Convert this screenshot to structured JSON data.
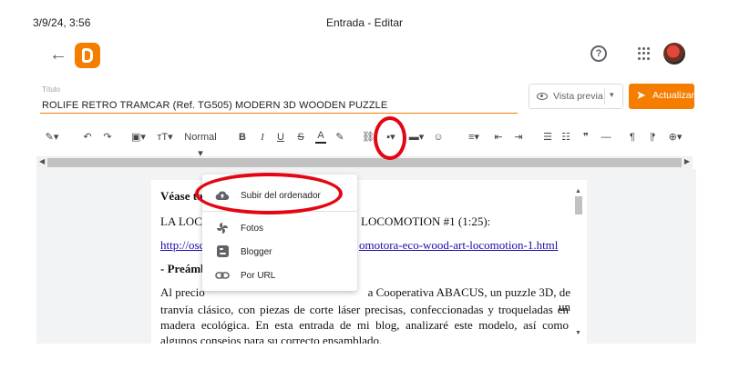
{
  "print_header": {
    "date": "3/9/24, 3:56",
    "title": "Entrada - Editar"
  },
  "appbar": {
    "help_glyph": "?"
  },
  "post": {
    "title_label": "Título",
    "title_value": "ROLIFE RETRO TRAMCAR (Ref. TG505) MODERN 3D WOODEN PUZZLE"
  },
  "actions": {
    "preview_label": "Vista previa",
    "update_label": "Actualizar"
  },
  "toolbar": {
    "paragraph_style": "Normal",
    "glyphs": {
      "bold": "B",
      "italic": "I",
      "underline": "U",
      "strike": "S",
      "text_color": "A",
      "quote": "❞",
      "hr": "—",
      "ltr": "¶",
      "rtl": "¶"
    }
  },
  "insert_menu": {
    "items": [
      {
        "label": "Subir del ordenador",
        "icon": "cloud-upload-icon"
      },
      {
        "label": "Fotos",
        "icon": "google-photos-icon"
      },
      {
        "label": "Blogger",
        "icon": "blogger-icon"
      },
      {
        "label": "Por URL",
        "icon": "link-icon"
      }
    ]
  },
  "document": {
    "line1": "Véase ta",
    "line2a": "LA LOC",
    "line2b": "LOCOMOTION #1 (1:25):",
    "link_a": "http://osc",
    "link_b": "omotora-eco-wood-art-locomotion-1.html",
    "heading": "- Preámb",
    "para_a": "Al precio",
    "para_b": "a Cooperativa ABACUS, un puzzle 3D, de un",
    "para_rest": "tranvía clásico, con piezas de corte láser precisas, confeccionadas y troqueladas en madera ecológica. En esta entrada de mi blog, analizaré este modelo, así como algunos consejos para su correcto ensamblado."
  },
  "colors": {
    "accent": "#f57d00",
    "annotation": "#e30613"
  }
}
